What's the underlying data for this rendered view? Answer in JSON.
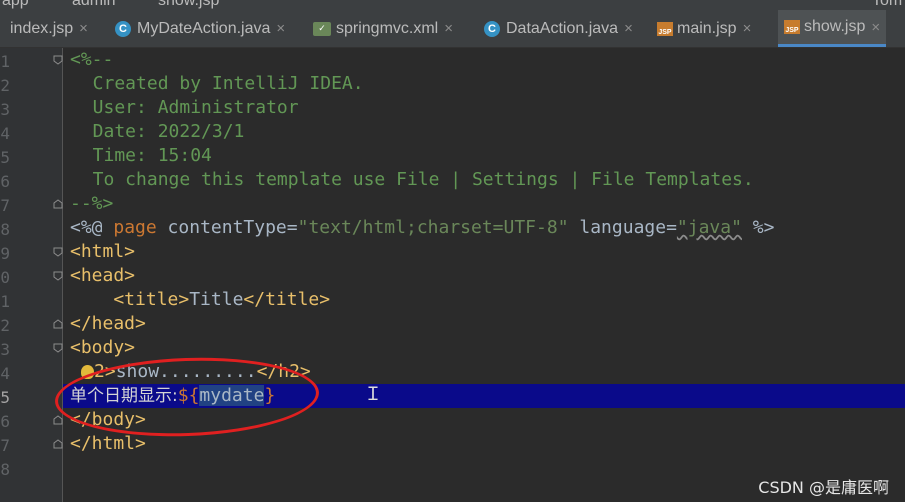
{
  "breadcrumb": {
    "segments": [
      "app",
      "admin",
      "show.jsp"
    ],
    "right_text": "Tom"
  },
  "tabs": [
    {
      "label": "index.jsp",
      "icon": "jsp-file-icon",
      "active": false
    },
    {
      "label": "MyDateAction.java",
      "icon": "java-class-icon",
      "active": false
    },
    {
      "label": "springmvc.xml",
      "icon": "xml-file-icon",
      "active": false
    },
    {
      "label": "DataAction.java",
      "icon": "java-class-icon",
      "active": false
    },
    {
      "label": "main.jsp",
      "icon": "jsp-file-icon",
      "active": false
    },
    {
      "label": "show.jsp",
      "icon": "jsp-file-icon",
      "active": true
    }
  ],
  "close_glyph": "×",
  "line_numbers": [
    "1",
    "2",
    "3",
    "4",
    "5",
    "6",
    "7",
    "8",
    "9",
    "0",
    "1",
    "2",
    "3",
    "4",
    "5",
    "6",
    "7",
    "8"
  ],
  "code": {
    "l1": "<%--",
    "l2": "  Created by IntelliJ IDEA.",
    "l3": "  User: Administrator",
    "l4": "  Date: 2022/3/1",
    "l5": "  Time: 15:04",
    "l6": "  To change this template use File | Settings | File Templates.",
    "l7": "--%>",
    "l8": {
      "a": "<%@ ",
      "b": "page",
      "c": " contentType=",
      "d": "\"text/html;charset=UTF-8\"",
      "e": " language=",
      "f": "\"java\"",
      "g": " %>"
    },
    "l9": "<html>",
    "l10": "<head>",
    "l11": {
      "a": "    <title>",
      "b": "Title",
      "c": "</title>"
    },
    "l12": "</head>",
    "l13": "<body>",
    "l14": {
      "a": "2>",
      "b": "show.........",
      "c": "</h2>"
    },
    "l15": {
      "a": "单个日期显示:",
      "b": "${",
      "c": "mydate",
      "d": "}"
    },
    "l16": "</body>",
    "l17": "</html>"
  },
  "watermark": "CSDN @是庸医啊",
  "colors": {
    "highlight_line": "#0a0a8a",
    "annotation_circle": "#e02020",
    "active_tab_underline": "#4a88c7"
  }
}
